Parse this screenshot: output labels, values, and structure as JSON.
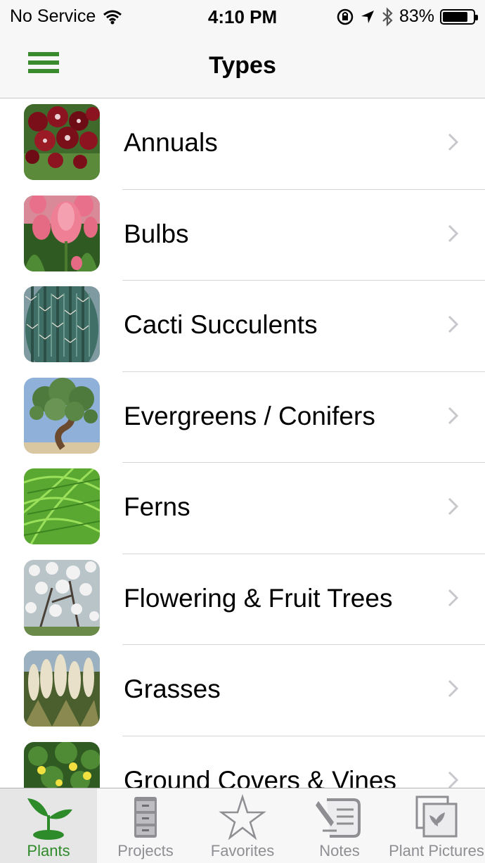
{
  "status_bar": {
    "carrier": "No Service",
    "time": "4:10 PM",
    "battery_percent": "83%",
    "battery_level": 0.83
  },
  "nav": {
    "title": "Types"
  },
  "list": {
    "items": [
      {
        "label": "Annuals",
        "icon": "red-flowers-thumbnail"
      },
      {
        "label": "Bulbs",
        "icon": "tulips-thumbnail"
      },
      {
        "label": "Cacti Succulents",
        "icon": "cactus-thumbnail"
      },
      {
        "label": "Evergreens / Conifers",
        "icon": "conifer-tree-thumbnail"
      },
      {
        "label": "Ferns",
        "icon": "fern-thumbnail"
      },
      {
        "label": "Flowering & Fruit Trees",
        "icon": "blossom-tree-thumbnail"
      },
      {
        "label": "Grasses",
        "icon": "pampas-grass-thumbnail"
      },
      {
        "label": "Ground Covers & Vines",
        "icon": "ground-cover-thumbnail"
      }
    ]
  },
  "tabs": [
    {
      "label": "Plants",
      "icon": "sprout-icon",
      "active": true
    },
    {
      "label": "Projects",
      "icon": "file-cabinet-icon",
      "active": false
    },
    {
      "label": "Favorites",
      "icon": "star-icon",
      "active": false
    },
    {
      "label": "Notes",
      "icon": "notes-icon",
      "active": false
    },
    {
      "label": "Plant Pictures",
      "icon": "pictures-icon",
      "active": false
    }
  ],
  "colors": {
    "accent": "#3a8a2e",
    "tab_inactive": "#8e8e93",
    "separator": "#d6d6da"
  }
}
